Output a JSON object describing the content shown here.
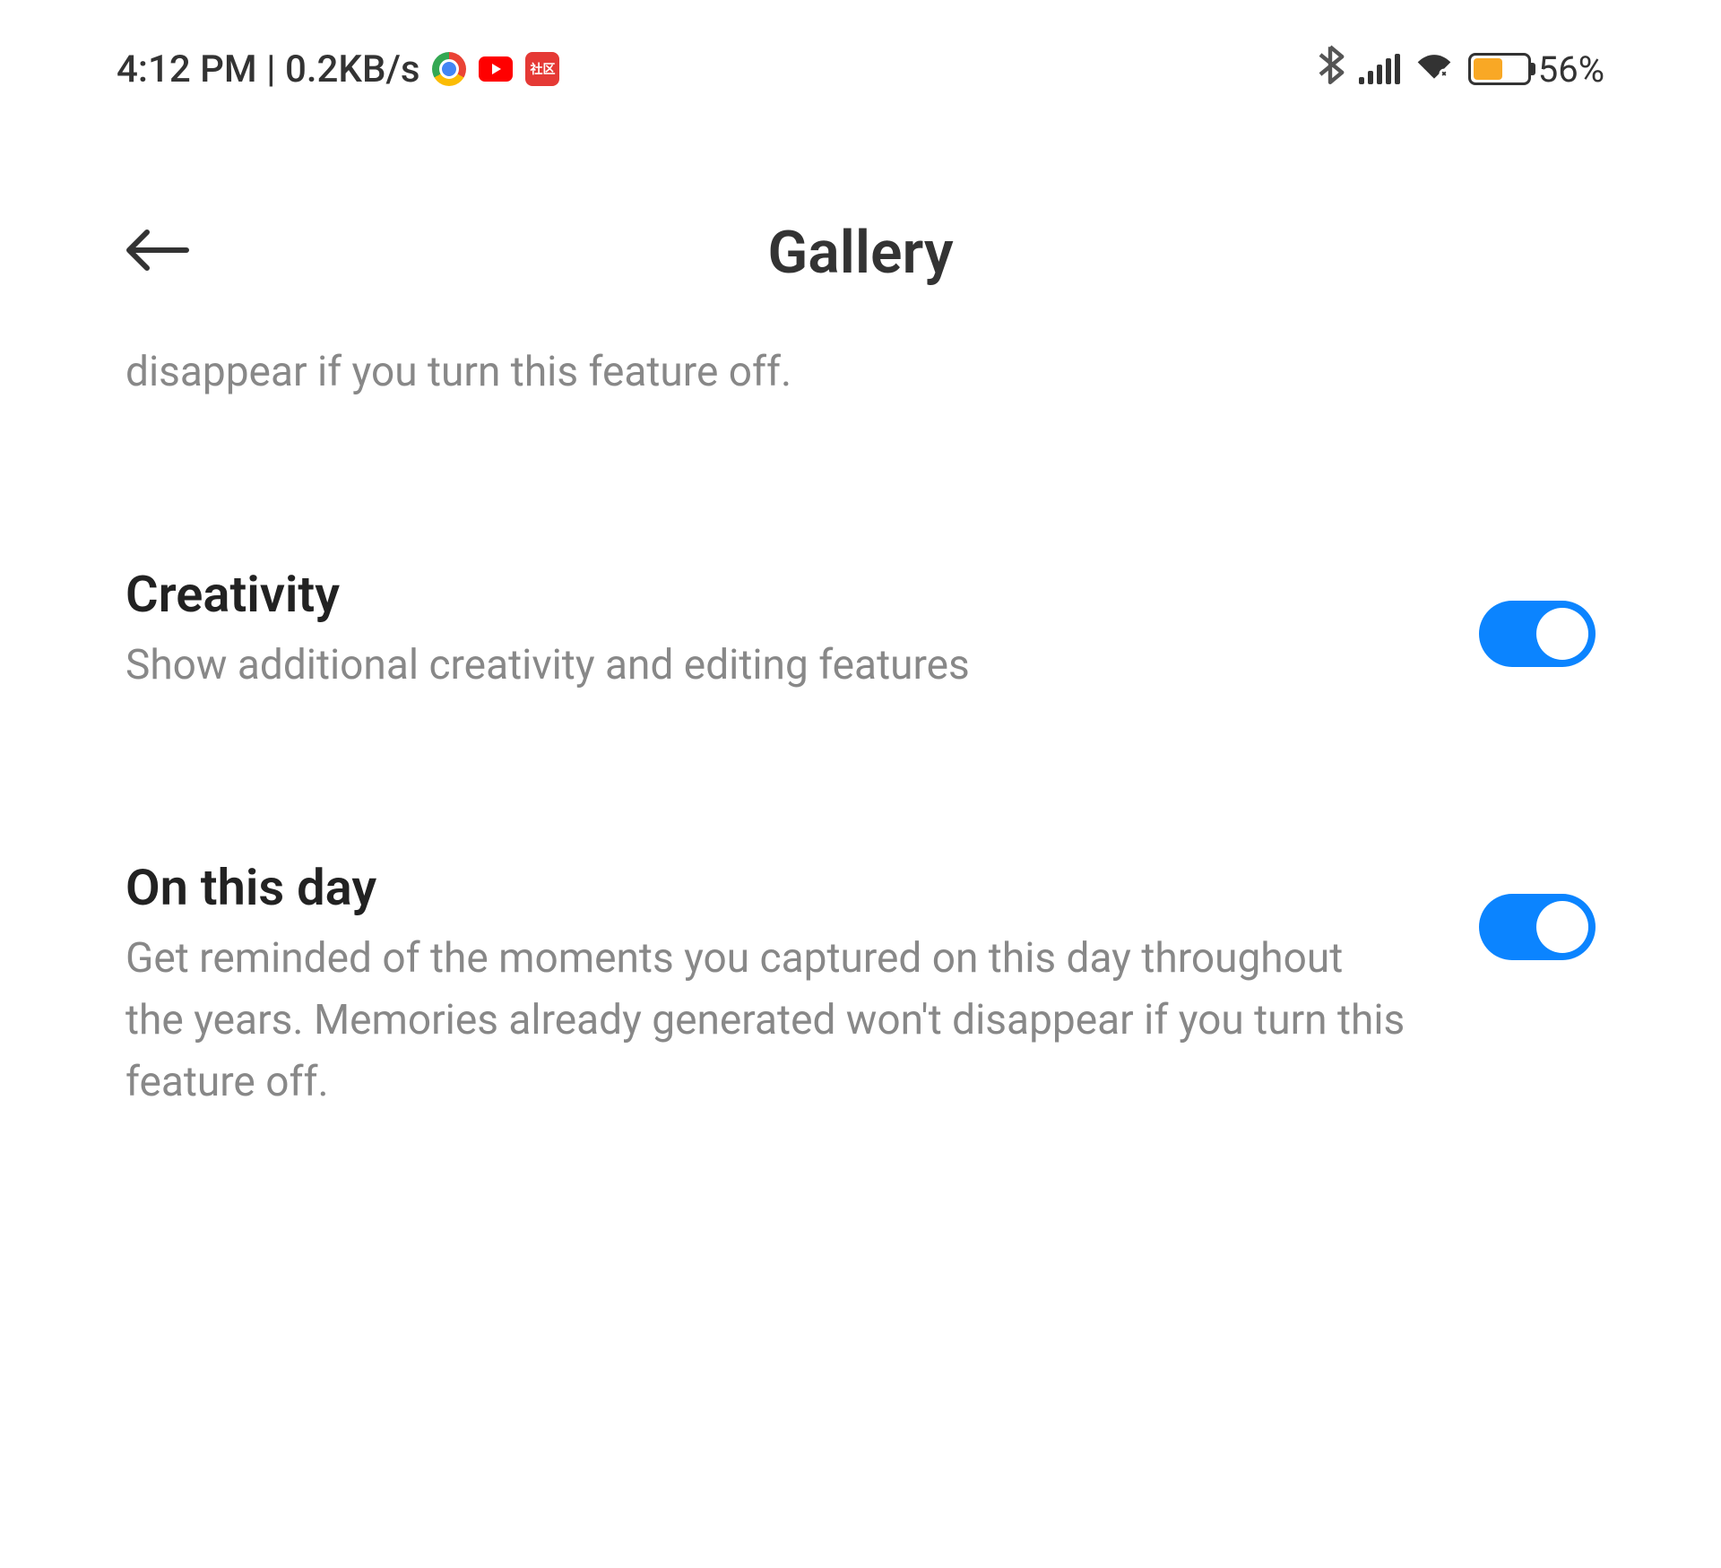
{
  "statusBar": {
    "time": "4:12 PM",
    "dataRate": "0.2KB/s",
    "batteryPercent": "56%",
    "batteryFill": 56
  },
  "header": {
    "title": "Gallery"
  },
  "partialDescription": "disappear if you turn this feature off.",
  "settings": [
    {
      "title": "Creativity",
      "description": "Show additional creativity and editing features",
      "enabled": true
    },
    {
      "title": "On this day",
      "description": "Get reminded of the moments you captured on this day throughout the years. Memories already generated won't disappear if you turn this feature off.",
      "enabled": true
    }
  ]
}
